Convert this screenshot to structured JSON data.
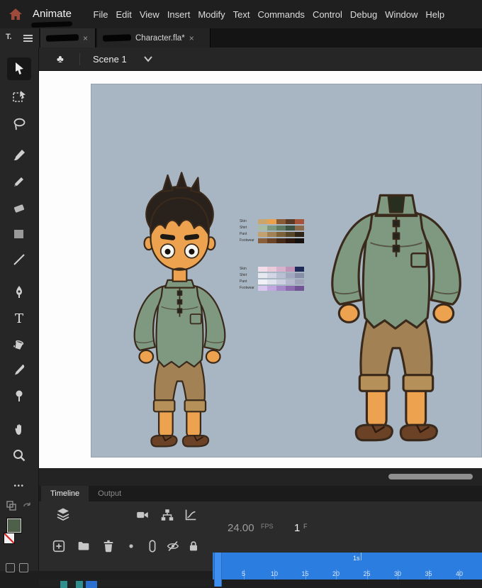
{
  "colors": {
    "accent_blue": "#2b7de0",
    "stage_background": "#a8b5c3",
    "fill_swatch": "#4e6049",
    "character_skin": "#eca24e",
    "character_hair": "#29211b",
    "character_shirt": "#7e997f",
    "character_pants": "#a28254",
    "character_sandals": "#6b4226"
  },
  "menubar": {
    "app_label": "Animate",
    "items": [
      "File",
      "Edit",
      "View",
      "Insert",
      "Modify",
      "Text",
      "Commands",
      "Control",
      "Debug",
      "Window",
      "Help"
    ]
  },
  "tabbar": {
    "tab1_redacted": true,
    "tab2_label": "Character.fla*",
    "close_glyph": "×"
  },
  "tools_panel": {
    "header_label": "T.",
    "text_glyph": "T",
    "more_glyph": "•••",
    "tools": [
      "selection",
      "free-transform",
      "lasso",
      "brush",
      "pencil",
      "eraser",
      "rectangle",
      "line",
      "pen",
      "text",
      "paint-bucket",
      "eyedropper",
      "asset-warp",
      "hand",
      "zoom",
      "more-options"
    ]
  },
  "editbar": {
    "symbol_glyph": "♣",
    "scene_label": "Scene 1"
  },
  "stage": {
    "palette_day": {
      "rows": [
        {
          "label": "Skin",
          "colors": [
            "#caa66f",
            "#e8a14f",
            "#8a5a34",
            "#5a3a26",
            "#a8543a"
          ]
        },
        {
          "label": "Shirt",
          "colors": [
            "#a8bca4",
            "#7e997f",
            "#5e7a62",
            "#3e5244",
            "#8a6a4a"
          ]
        },
        {
          "label": "Pant",
          "colors": [
            "#c2a070",
            "#a28254",
            "#7d6138",
            "#584628",
            "#302416"
          ]
        },
        {
          "label": "Footwear",
          "colors": [
            "#8a5f3c",
            "#6b4428",
            "#452a18",
            "#2a180e",
            "#14100c"
          ]
        }
      ]
    },
    "palette_night": {
      "rows": [
        {
          "label": "Skin",
          "colors": [
            "#f2dee8",
            "#e8cadb",
            "#d8b2cc",
            "#c094b8",
            "#202a58"
          ]
        },
        {
          "label": "Shirt",
          "colors": [
            "#e6e8f0",
            "#d2d6e4",
            "#bac0d4",
            "#a2a8c0",
            "#888ea6"
          ]
        },
        {
          "label": "Pant",
          "colors": [
            "#f0f0f6",
            "#e0e2ee",
            "#ccd0e0",
            "#b6bace",
            "#a0a4ba"
          ]
        },
        {
          "label": "Footwear",
          "colors": [
            "#d8c6ec",
            "#c0a8de",
            "#a689c8",
            "#8c6cae",
            "#725494"
          ]
        }
      ]
    }
  },
  "timeline": {
    "tab_timeline": "Timeline",
    "tab_output": "Output",
    "fps_value": "24.00",
    "fps_unit": "FPS",
    "frame_value": "1",
    "frame_unit": "F",
    "seconds_label": "1s",
    "ruler_ticks": [
      5,
      10,
      15,
      20,
      25,
      30,
      35,
      40
    ]
  }
}
